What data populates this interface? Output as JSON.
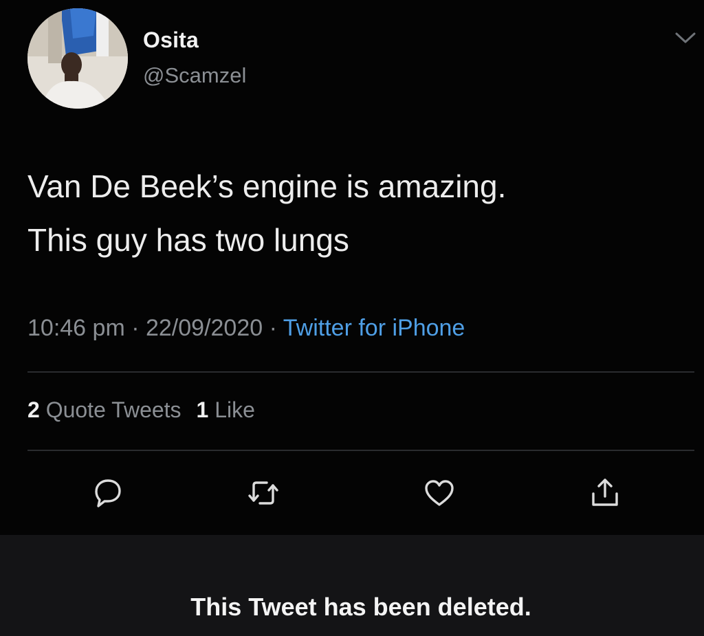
{
  "tweet": {
    "author": {
      "display_name": "Osita",
      "handle": "@Scamzel",
      "avatar_icon": "profile-photo"
    },
    "menu_icon": "chevron-down-icon",
    "text_lines": [
      "Van De Beek’s engine is amazing.",
      "This guy has two lungs"
    ],
    "time": "10:46 pm",
    "separator": " · ",
    "date": "22/09/2020",
    "source": "Twitter for iPhone",
    "stats": {
      "quote_count": "2",
      "quote_label": "Quote Tweets",
      "like_count": "1",
      "like_label": "Like"
    },
    "actions": [
      {
        "name": "reply",
        "icon": "speech-bubble-icon"
      },
      {
        "name": "retweet",
        "icon": "retweet-icon"
      },
      {
        "name": "like",
        "icon": "heart-icon"
      },
      {
        "name": "share",
        "icon": "share-icon"
      }
    ]
  },
  "banner": {
    "message": "This Tweet has been deleted."
  },
  "colors": {
    "background": "#040404",
    "primary_text": "#ededed",
    "secondary_text": "#8b8f94",
    "link": "#4f9fe6",
    "banner_background": "#141416",
    "divider": "#2a2c2f"
  }
}
